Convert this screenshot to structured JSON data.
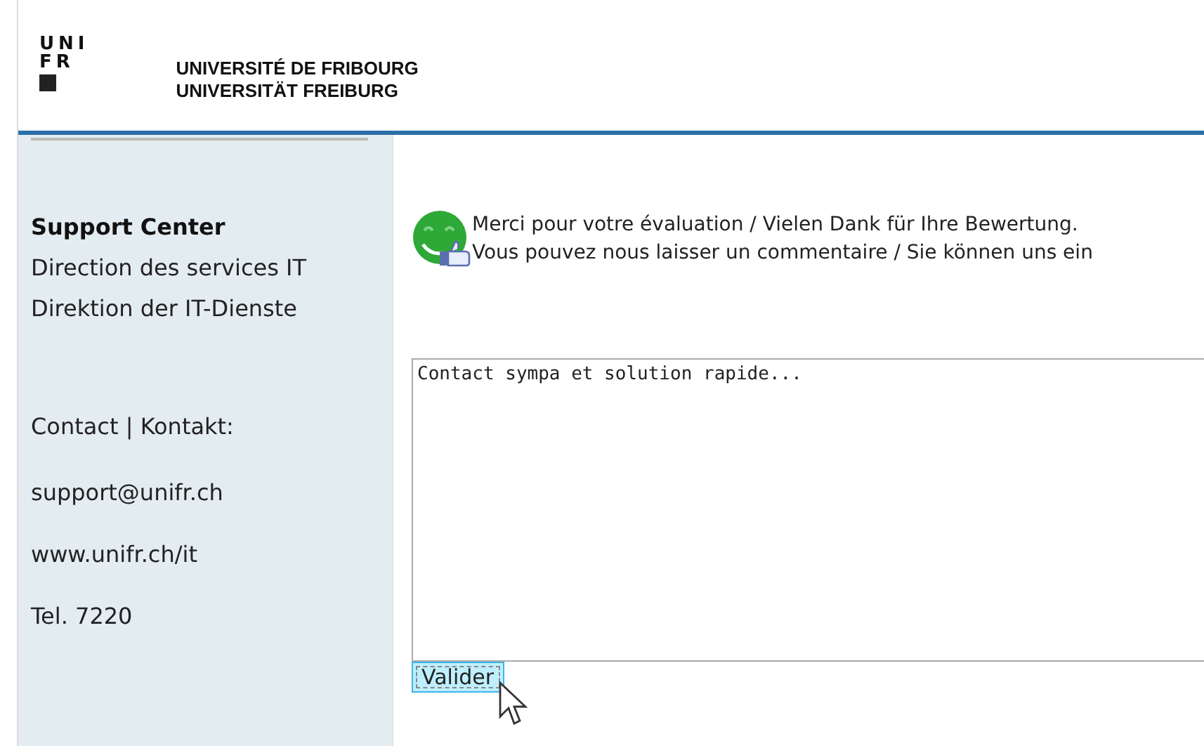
{
  "header": {
    "logo_lines": [
      "UNI",
      "FR"
    ],
    "university_names": [
      "UNIVERSITÉ DE FRIBOURG",
      "UNIVERSITÄT FREIBURG"
    ]
  },
  "sidebar": {
    "title": "Support Center",
    "lines": [
      "Direction des services IT",
      "Direktion der IT-Dienste"
    ],
    "contact_label": "Contact | Kontakt:",
    "contacts": [
      "support@unifr.ch",
      "www.unifr.ch/it",
      "Tel. 7220"
    ]
  },
  "message": {
    "lines": [
      "Merci pour votre évaluation / Vielen Dank für Ihre Bewertung.",
      "Vous pouvez nous laisser un commentaire / Sie können uns ein"
    ]
  },
  "comment": {
    "value": "Contact sympa et solution rapide..."
  },
  "submit_button": {
    "label": "Valider"
  }
}
